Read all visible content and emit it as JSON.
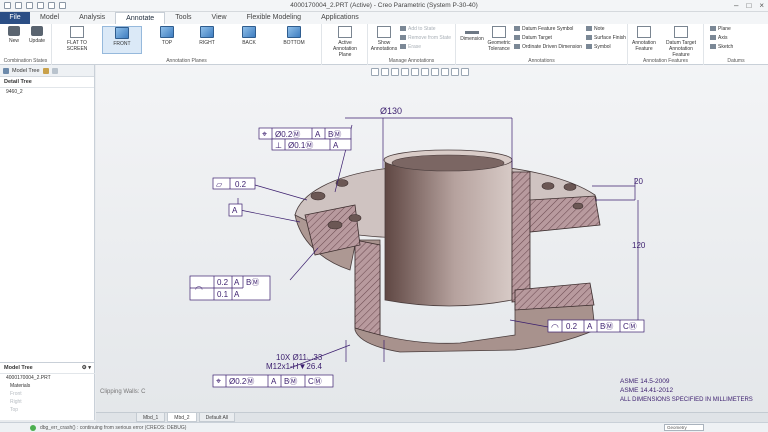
{
  "window": {
    "title": "4000170004_2.PRT (Active) - Creo Parametric (System P-30-40)"
  },
  "tabs": [
    "File",
    "Model",
    "Analysis",
    "Annotate",
    "Tools",
    "View",
    "Flexible Modeling",
    "Applications"
  ],
  "ribbon": {
    "combination_states": {
      "new": "New",
      "update": "Update",
      "label": "Combination States"
    },
    "annotation_planes": {
      "flat_to_screen": "FLAT TO SCREEN",
      "front": "FRONT",
      "top": "TOP",
      "right": "RIGHT",
      "back": "BACK",
      "bottom": "BOTTOM",
      "label": "Annotation Planes"
    },
    "active_annotation_plane": "Active Annotation Plane",
    "manage": {
      "show": "Show Annotations",
      "add_to_state": "Add to State",
      "remove_from_state": "Remove from State",
      "erase": "Erase",
      "label": "Manage Annotations"
    },
    "annotations": {
      "dimension": "Dimension",
      "geometric_tolerance": "Geometric Tolerance",
      "datum_feature_symbol": "Datum Feature Symbol",
      "datum_target": "Datum Target",
      "ordinate_driven_dimension": "Ordinate Driven Dimension",
      "note": "Note",
      "surface_finish": "Surface Finish",
      "symbol": "Symbol",
      "label": "Annotations"
    },
    "features": {
      "annotation_feature": "Annotation Feature",
      "datum_target_annotation_feature": "Datum Target Annotation Feature",
      "label": "Annotation Features"
    },
    "datums": {
      "plane": "Plane",
      "axis": "Axis",
      "sketch": "Sketch",
      "label": "Datums"
    }
  },
  "leftpane": {
    "tab1": "Model Tree",
    "detail_tree": "Detail Tree",
    "detail_item": "9460_2",
    "model_tree_label": "Model Tree",
    "part": "4000170004_2.PRT",
    "items": [
      "Materials",
      "Front",
      "Right",
      "Top"
    ]
  },
  "annotations": {
    "dia_130": "Ø130",
    "fcf_pos_1": "Ø0.2Ⓜ",
    "fcf_pos_1_a": "A",
    "fcf_pos_1_b": "BⓂ",
    "fcf_perp_1": "Ø0.1Ⓜ",
    "fcf_perp_1_a": "A",
    "flatness_val": "0.2",
    "datum_a": "A",
    "profile_val_1": "0.2",
    "profile_ref_a": "A",
    "profile_ref_b": "BⓂ",
    "profile_val_2": "0.1",
    "profile_ref_2": "A",
    "dim_20": "20",
    "dim_120": "120",
    "profile_right": "0.2",
    "profile_right_a": "A",
    "profile_right_b": "BⓂ",
    "profile_right_c": "CⓂ",
    "holes_line1": "10X Ø11⌴33",
    "holes_line2": "M12x1-H▼26.4",
    "fcf_bottom": "Ø0.2Ⓜ",
    "fcf_bottom_a": "A",
    "fcf_bottom_b": "BⓂ",
    "fcf_bottom_c": "CⓂ",
    "clipping": "Clipping Walls: C",
    "std1": "ASME 14.5-2009",
    "std2": "ASME 14.41-2012",
    "std3": "ALL DIMENSIONS SPECIFIED IN MILLIMETERS"
  },
  "model_tabs": [
    "Mbd_1",
    "Mbd_2",
    "Default All"
  ],
  "status": {
    "message": "dbg_err_crash() : continuing from serious error (CREOS: DEBUG)",
    "filter": "Geometry"
  }
}
